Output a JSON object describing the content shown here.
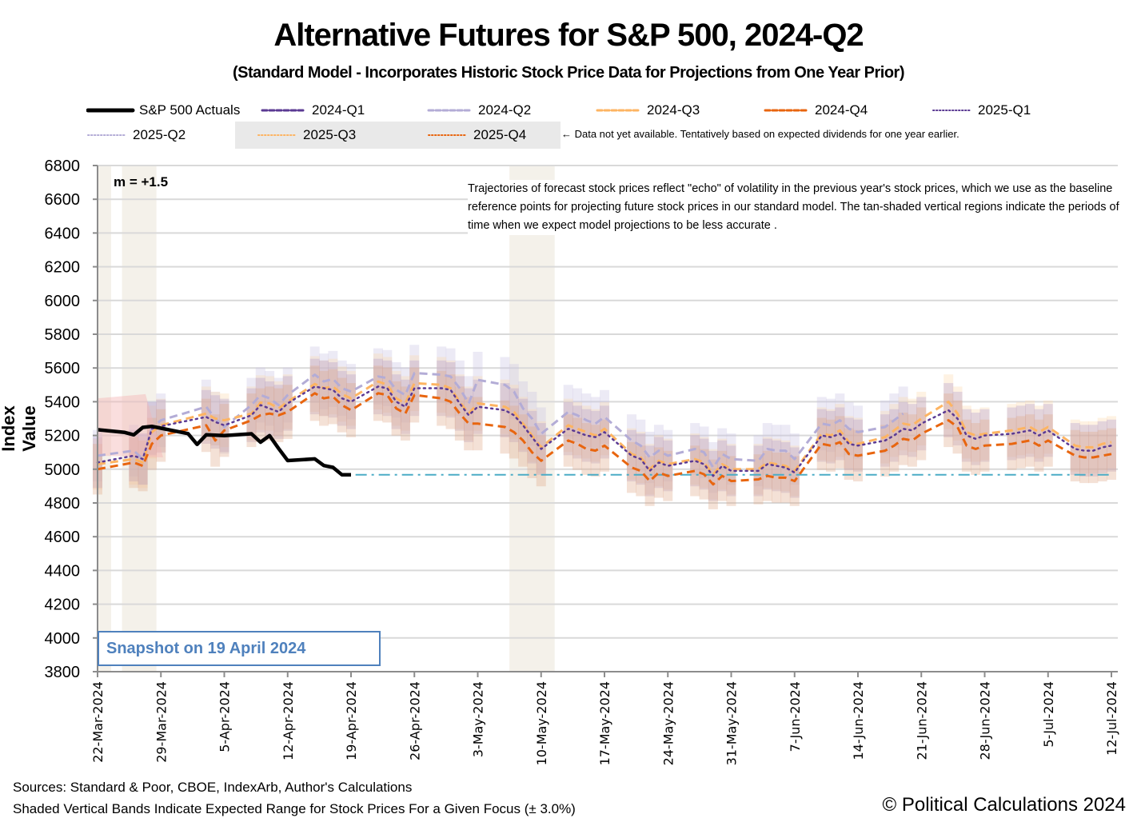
{
  "title": "Alternative Futures for S&P 500, 2024-Q2",
  "subtitle": "(Standard Model - Incorporates Historic Stock Price Data for Projections from One Year Prior)",
  "legend": {
    "items": [
      {
        "label": "S&P 500 Actuals",
        "color": "#000000",
        "style": "solid-thick"
      },
      {
        "label": "2024-Q1",
        "color": "#5b3a93",
        "style": "dashed"
      },
      {
        "label": "2024-Q2",
        "color": "#b3acd6",
        "style": "dashed"
      },
      {
        "label": "2024-Q3",
        "color": "#fdb462",
        "style": "dashed"
      },
      {
        "label": "2024-Q4",
        "color": "#e8650f",
        "style": "dashed"
      },
      {
        "label": "2025-Q1",
        "color": "#5b3a93",
        "style": "dotted"
      },
      {
        "label": "2025-Q2",
        "color": "#b3acd6",
        "style": "dotted"
      },
      {
        "label": "2025-Q3",
        "color": "#fdb462",
        "style": "dotted"
      },
      {
        "label": "2025-Q4",
        "color": "#e8650f",
        "style": "dotted"
      }
    ],
    "note": "← Data not yet available.  Tentatively based on expected dividends for one year earlier."
  },
  "annotations": {
    "m_value": "m = +1.5",
    "description": "Trajectories of forecast stock prices reflect \"echo\" of volatility in  the previous year's stock prices, which we use as the baseline reference points for projecting future stock prices in our standard model.   The tan-shaded vertical regions indicate the periods of time when we expect model projections to be less accurate .",
    "snapshot": "Snapshot on 19 April 2024"
  },
  "footer": {
    "sources": "Sources: Standard & Poor, CBOE, IndexArb, Author's Calculations",
    "bands_note": "Shaded Vertical Bands Indicate Expected Range for Stock Prices For a Given Focus (± 3.0%)",
    "copyright": "© Political Calculations 2024"
  },
  "chart_data": {
    "type": "line",
    "title": "Alternative Futures for S&P 500, 2024-Q2",
    "xlabel": "",
    "ylabel": "Index Value",
    "ylim": [
      3800,
      6800
    ],
    "yticks": [
      3800,
      4000,
      4200,
      4400,
      4600,
      4800,
      5000,
      5200,
      5400,
      5600,
      5800,
      6000,
      6200,
      6400,
      6600,
      6800
    ],
    "xrange": [
      "2024-03-22",
      "2024-07-12"
    ],
    "xtick_labels": [
      "22-Mar-2024",
      "29-Mar-2024",
      "5-Apr-2024",
      "12-Apr-2024",
      "19-Apr-2024",
      "26-Apr-2024",
      "3-May-2024",
      "10-May-2024",
      "17-May-2024",
      "24-May-2024",
      "31-May-2024",
      "7-Jun-2024",
      "14-Jun-2024",
      "21-Jun-2024",
      "28-Jun-2024",
      "5-Jul-2024",
      "12-Jul-2024"
    ],
    "grid": true,
    "legend_position": "top",
    "band_pct": 3.0,
    "reference_level": 4967,
    "tan_regions_days": [
      [
        0,
        1.5
      ],
      [
        2.7,
        6.5
      ],
      [
        45.5,
        50.5
      ]
    ],
    "series": [
      {
        "name": "S&P 500 Actuals",
        "days": [
          0,
          3,
          4,
          5,
          6,
          7,
          10,
          11,
          12,
          13,
          14,
          17,
          18,
          19,
          20,
          21,
          24,
          25,
          26,
          27,
          28
        ],
        "values": [
          5234,
          5218,
          5204,
          5248,
          5254,
          5243,
          5211,
          5147,
          5204,
          5202,
          5199,
          5210,
          5160,
          5199,
          5123,
          5051,
          5061,
          5022,
          5011,
          4967,
          4967
        ]
      },
      {
        "name": "2024-Q2",
        "days": [
          0,
          4,
          5,
          6,
          7,
          12,
          13,
          14,
          17,
          18,
          19,
          20,
          21,
          24,
          25,
          26,
          27,
          28,
          31,
          32,
          33,
          34,
          35,
          38,
          39,
          40,
          41,
          42,
          45,
          46,
          47,
          48,
          49,
          52,
          53,
          54,
          55,
          56,
          59,
          60,
          61,
          62,
          63,
          66,
          67,
          68,
          69,
          70,
          73,
          74,
          75,
          76,
          77,
          80,
          81,
          82,
          83,
          84,
          87,
          88,
          89
        ],
        "values": [
          5080,
          5110,
          5060,
          5245,
          5290,
          5370,
          5300,
          5250,
          5380,
          5440,
          5420,
          5380,
          5440,
          5560,
          5520,
          5535,
          5480,
          5460,
          5550,
          5540,
          5470,
          5440,
          5570,
          5560,
          5550,
          5480,
          5390,
          5530,
          5500,
          5460,
          5360,
          5300,
          5210,
          5340,
          5320,
          5290,
          5270,
          5310,
          5170,
          5140,
          5070,
          5110,
          5080,
          5120,
          5100,
          5010,
          5090,
          5060,
          5050,
          5120,
          5110,
          5110,
          5060,
          5270,
          5260,
          5290,
          5240,
          5220,
          5250,
          5290,
          5330
        ]
      },
      {
        "name": "2024-Q3",
        "days": [
          0,
          4,
          5,
          6,
          7,
          12,
          13,
          14,
          17,
          18,
          19,
          20,
          21,
          24,
          25,
          26,
          27,
          28,
          31,
          32,
          33,
          34,
          35,
          38,
          39,
          40,
          41,
          42,
          45,
          46,
          47,
          48,
          49,
          52,
          53,
          54,
          55,
          56,
          59,
          60,
          61,
          62,
          63,
          66,
          67,
          68,
          69,
          70,
          73,
          74,
          75,
          76,
          77,
          80,
          81,
          82,
          83,
          84,
          87,
          88,
          89,
          90,
          91,
          94,
          95,
          96,
          97,
          98,
          101,
          102,
          103,
          104,
          105,
          108,
          109,
          110,
          111,
          112
        ],
        "values": [
          5030,
          5060,
          5040,
          5220,
          5260,
          5330,
          5300,
          5290,
          5330,
          5395,
          5390,
          5360,
          5400,
          5505,
          5480,
          5490,
          5445,
          5420,
          5520,
          5500,
          5420,
          5390,
          5510,
          5500,
          5480,
          5400,
          5330,
          5390,
          5370,
          5340,
          5270,
          5200,
          5130,
          5260,
          5240,
          5220,
          5200,
          5240,
          5090,
          5070,
          5000,
          5050,
          5030,
          5060,
          5040,
          4970,
          5030,
          5000,
          5000,
          5040,
          5030,
          5020,
          4990,
          5210,
          5200,
          5230,
          5160,
          5150,
          5190,
          5230,
          5270,
          5260,
          5300,
          5400,
          5330,
          5220,
          5200,
          5210,
          5230,
          5240,
          5250,
          5220,
          5250,
          5140,
          5130,
          5130,
          5150,
          5160
        ]
      },
      {
        "name": "2025-Q1",
        "days": [
          0,
          4,
          5,
          6,
          7,
          12,
          13,
          14,
          17,
          18,
          19,
          20,
          21,
          24,
          25,
          26,
          27,
          28,
          31,
          32,
          33,
          34,
          35,
          38,
          39,
          40,
          41,
          42,
          45,
          46,
          47,
          48,
          49,
          52,
          53,
          54,
          55,
          56,
          59,
          60,
          61,
          62,
          63,
          66,
          67,
          68,
          69,
          70,
          73,
          74,
          75,
          76,
          77,
          80,
          81,
          82,
          83,
          84,
          87,
          88,
          89,
          90,
          91,
          94,
          95,
          96,
          97,
          98,
          101,
          102,
          103,
          104,
          105,
          108,
          109,
          110,
          111,
          112
        ],
        "values": [
          5040,
          5080,
          5060,
          5240,
          5255,
          5310,
          5280,
          5260,
          5320,
          5380,
          5360,
          5340,
          5390,
          5490,
          5480,
          5470,
          5420,
          5400,
          5490,
          5480,
          5400,
          5370,
          5480,
          5480,
          5470,
          5390,
          5320,
          5370,
          5350,
          5320,
          5260,
          5190,
          5120,
          5240,
          5220,
          5200,
          5190,
          5220,
          5080,
          5060,
          4990,
          5040,
          5020,
          5050,
          5030,
          4960,
          5020,
          4990,
          4990,
          5030,
          5020,
          5010,
          4980,
          5200,
          5190,
          5210,
          5150,
          5140,
          5170,
          5200,
          5240,
          5230,
          5270,
          5350,
          5300,
          5200,
          5180,
          5200,
          5210,
          5220,
          5230,
          5200,
          5230,
          5120,
          5110,
          5110,
          5130,
          5140
        ]
      },
      {
        "name": "2024-Q4",
        "days": [
          0,
          4,
          5,
          6,
          7,
          12,
          13,
          14,
          17,
          18,
          19,
          20,
          21,
          24,
          25,
          26,
          27,
          28,
          31,
          32,
          33,
          34,
          35,
          38,
          39,
          40,
          41,
          42,
          45,
          46,
          47,
          48,
          49,
          52,
          53,
          54,
          55,
          56,
          59,
          60,
          61,
          62,
          63,
          66,
          67,
          68,
          69,
          70,
          73,
          74,
          75,
          76,
          77,
          80,
          81,
          82,
          83,
          84,
          87,
          88,
          89,
          90,
          91,
          94,
          95,
          96,
          97,
          98,
          101,
          102,
          103,
          104,
          105,
          108,
          109,
          110,
          111,
          112
        ],
        "values": [
          5000,
          5040,
          5020,
          5150,
          5200,
          5260,
          5170,
          5230,
          5290,
          5320,
          5330,
          5320,
          5340,
          5450,
          5420,
          5430,
          5380,
          5350,
          5450,
          5440,
          5360,
          5330,
          5440,
          5420,
          5400,
          5330,
          5270,
          5270,
          5250,
          5220,
          5170,
          5100,
          5050,
          5170,
          5150,
          5120,
          5110,
          5140,
          5010,
          4990,
          4930,
          4980,
          4960,
          4990,
          4970,
          4910,
          4960,
          4930,
          4940,
          4960,
          4950,
          4950,
          4930,
          5150,
          5140,
          5160,
          5090,
          5080,
          5110,
          5140,
          5180,
          5170,
          5210,
          5290,
          5250,
          5140,
          5120,
          5140,
          5150,
          5160,
          5170,
          5140,
          5170,
          5080,
          5070,
          5070,
          5080,
          5090
        ]
      }
    ]
  }
}
